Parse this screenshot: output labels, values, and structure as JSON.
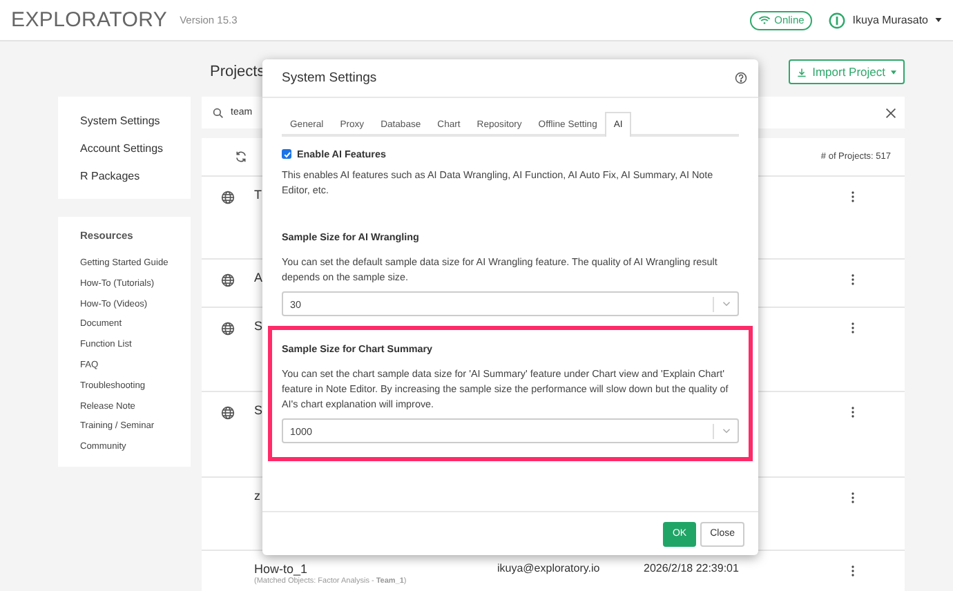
{
  "app": {
    "logo": "EXPLORATORY",
    "version": "Version 15.3",
    "status": "Online",
    "user": "Ikuya Murasato"
  },
  "sidebar": {
    "settings": [
      {
        "label": "System Settings"
      },
      {
        "label": "Account Settings"
      },
      {
        "label": "R Packages"
      }
    ],
    "resources_title": "Resources",
    "resources": [
      {
        "label": "Getting Started Guide"
      },
      {
        "label": "How-To (Tutorials)"
      },
      {
        "label": "How-To (Videos)"
      },
      {
        "label": "Document"
      },
      {
        "label": "Function List"
      },
      {
        "label": "FAQ"
      },
      {
        "label": "Troubleshooting"
      },
      {
        "label": "Release Note"
      },
      {
        "label": "Training / Seminar"
      },
      {
        "label": "Community"
      }
    ]
  },
  "projects": {
    "title": "Projects",
    "import_button": "Import Project",
    "search": {
      "value": "team"
    },
    "count": "# of Projects: 517",
    "rows": [
      {
        "name": "T",
        "kind": "public"
      },
      {
        "name": "A",
        "kind": "public"
      },
      {
        "name": "S",
        "kind": "public"
      },
      {
        "name": "S",
        "kind": "public"
      },
      {
        "name": "z",
        "kind": "private"
      },
      {
        "name": "How-to_1",
        "kind": "private",
        "note": "(Matched Objects: Factor Analysis - **Team_1**)",
        "owner": "ikuya@exploratory.io",
        "updated": "2026/2/18 22:39:01"
      }
    ]
  },
  "dialog": {
    "title": "System Settings",
    "tabs": [
      {
        "label": "General",
        "selected": false
      },
      {
        "label": "Proxy",
        "selected": false
      },
      {
        "label": "Database",
        "selected": false
      },
      {
        "label": "Chart",
        "selected": false
      },
      {
        "label": "Repository",
        "selected": false
      },
      {
        "label": "Offline Setting",
        "selected": false
      },
      {
        "label": "AI",
        "selected": true
      }
    ],
    "enable_ai": {
      "label": "Enable AI Features",
      "checked": true
    },
    "enable_ai_description": "This enables AI features such as AI Data Wrangling, AI Function, AI Auto Fix, AI Summary, AI Note Editor, etc.",
    "sections": [
      {
        "title": "Sample Size for AI Wrangling",
        "description": "You can set the default sample data size for AI Wrangling feature. The quality of AI Wrangling result depends on the sample size.",
        "value": "30",
        "highlighted": false
      },
      {
        "title": "Sample Size for Chart Summary",
        "description": "You can set the chart sample data size for 'AI Summary' feature under Chart view and 'Explain Chart' feature in Note Editor. By increasing the sample size the performance will slow down but the quality of AI's chart explanation will improve.",
        "value": "1000",
        "highlighted": true
      }
    ],
    "buttons": [
      {
        "label": "OK",
        "kind": "primary"
      },
      {
        "label": "Close",
        "kind": "default"
      }
    ]
  }
}
